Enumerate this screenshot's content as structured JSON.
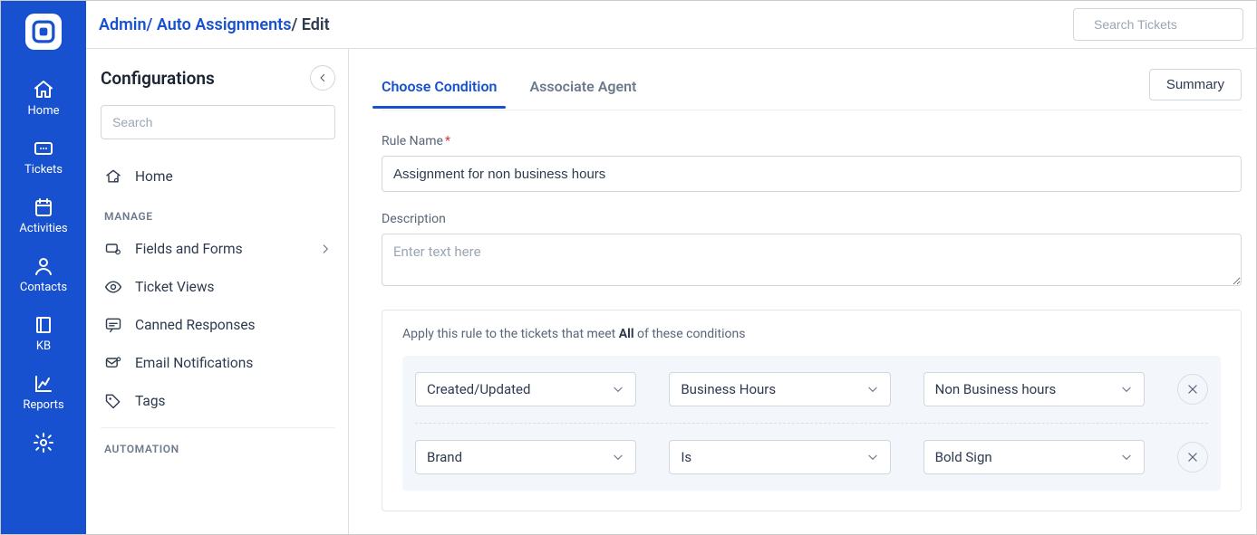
{
  "breadcrumb": {
    "root": "Admin",
    "parent": "Auto Assignments",
    "current": "Edit"
  },
  "topbar": {
    "search_placeholder": "Search Tickets"
  },
  "rail": {
    "items": [
      {
        "label": "Home",
        "icon": "home"
      },
      {
        "label": "Tickets",
        "icon": "ticket"
      },
      {
        "label": "Activities",
        "icon": "calendar"
      },
      {
        "label": "Contacts",
        "icon": "person"
      },
      {
        "label": "KB",
        "icon": "book"
      },
      {
        "label": "Reports",
        "icon": "chart"
      }
    ]
  },
  "sidebar": {
    "title": "Configurations",
    "search_placeholder": "Search",
    "home_label": "Home",
    "sections": [
      {
        "label": "MANAGE",
        "items": [
          {
            "label": "Fields and Forms",
            "icon": "ticket-gear",
            "expandable": true
          },
          {
            "label": "Ticket Views",
            "icon": "eye"
          },
          {
            "label": "Canned Responses",
            "icon": "chat"
          },
          {
            "label": "Email Notifications",
            "icon": "mail-bell"
          },
          {
            "label": "Tags",
            "icon": "tag"
          }
        ]
      },
      {
        "label": "AUTOMATION",
        "items": []
      }
    ]
  },
  "tabs": {
    "items": [
      {
        "label": "Choose Condition",
        "active": true
      },
      {
        "label": "Associate Agent",
        "active": false
      }
    ],
    "summary_label": "Summary"
  },
  "form": {
    "rule_name_label": "Rule Name",
    "rule_name_value": "Assignment for non business hours",
    "description_label": "Description",
    "description_placeholder": "Enter text here",
    "description_value": ""
  },
  "conditions": {
    "prefix": "Apply this rule to the tickets that meet ",
    "mode": "All",
    "suffix": " of these conditions",
    "rows": [
      {
        "field": "Created/Updated",
        "operator": "Business Hours",
        "value": "Non Business hours"
      },
      {
        "field": "Brand",
        "operator": "Is",
        "value": "Bold Sign"
      }
    ]
  }
}
